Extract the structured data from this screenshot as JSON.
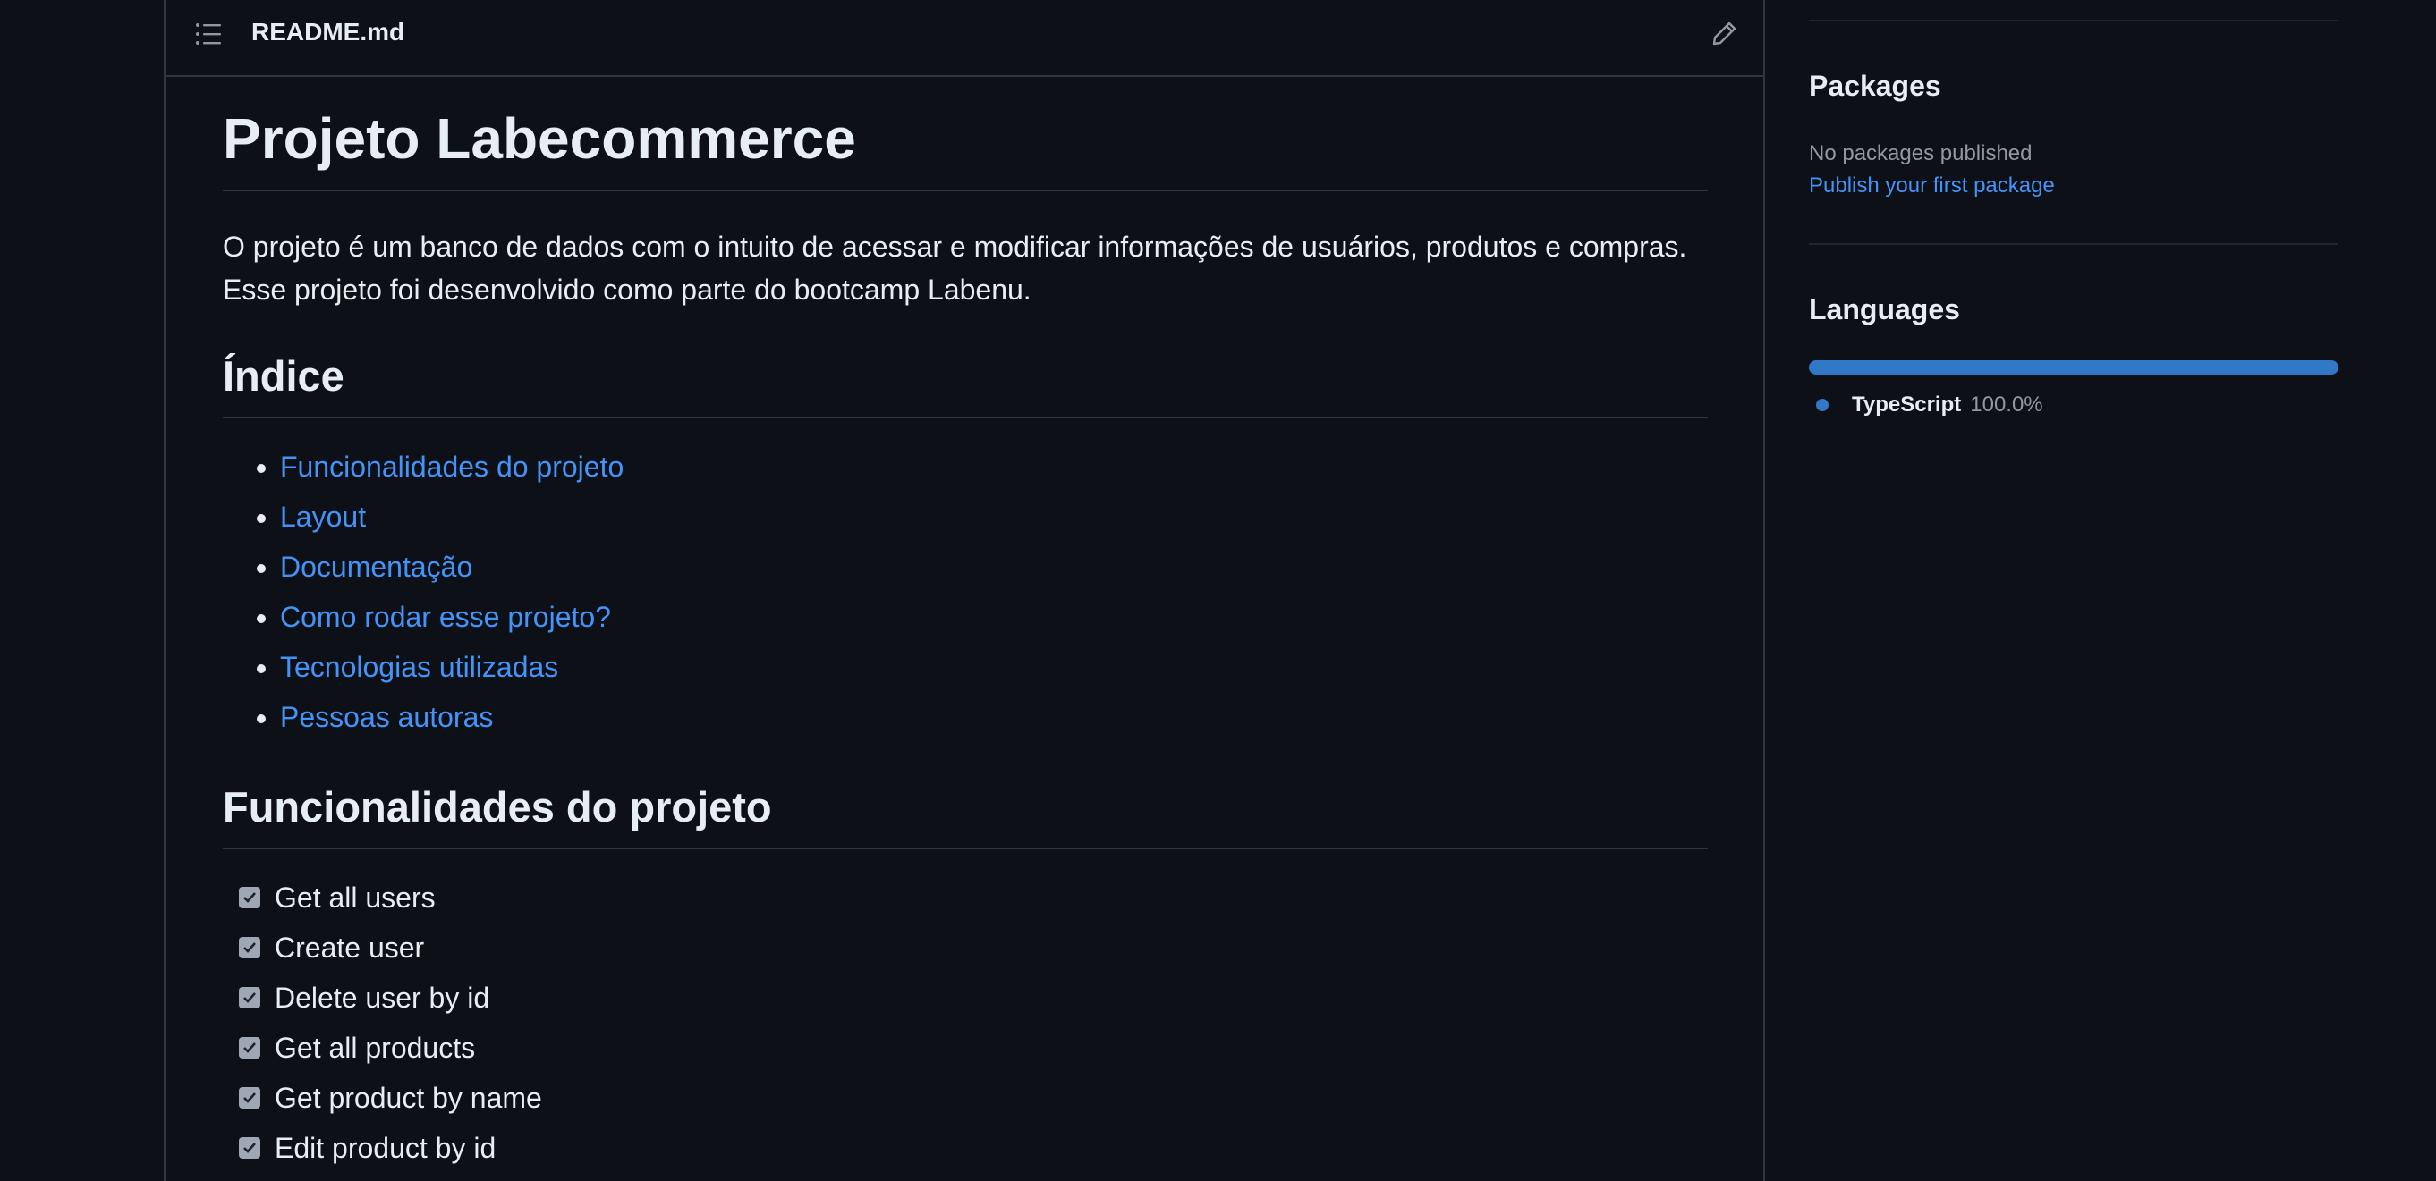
{
  "readme": {
    "filename": "README.md",
    "title": "Projeto Labecommerce",
    "intro": "O projeto é um banco de dados com o intuito de acessar e modificar informações de usuários, produtos e compras. Esse projeto foi desenvolvido como parte do bootcamp Labenu.",
    "index_heading": "Índice",
    "index_items": [
      {
        "label": "Funcionalidades do projeto"
      },
      {
        "label": "Layout"
      },
      {
        "label": "Documentação"
      },
      {
        "label": "Como rodar esse projeto?"
      },
      {
        "label": "Tecnologias utilizadas"
      },
      {
        "label": "Pessoas autoras"
      }
    ],
    "features_heading": "Funcionalidades do projeto",
    "features": [
      {
        "label": "Get all users",
        "checked": true
      },
      {
        "label": "Create user",
        "checked": true
      },
      {
        "label": "Delete user by id",
        "checked": true
      },
      {
        "label": "Get all products",
        "checked": true
      },
      {
        "label": "Get product by name",
        "checked": true
      },
      {
        "label": "Edit product by id",
        "checked": true
      }
    ]
  },
  "sidebar": {
    "packages": {
      "heading": "Packages",
      "empty_text": "No packages published",
      "link": "Publish your first package"
    },
    "languages": {
      "heading": "Languages",
      "items": [
        {
          "name": "TypeScript",
          "percent": "100.0%",
          "share": 1.0,
          "color": "#3178c6"
        }
      ]
    }
  },
  "icons": {
    "toc": "list-unordered-icon",
    "edit": "pencil-icon",
    "check": "check-icon"
  },
  "colors": {
    "background": "#0d1117",
    "border": "#30363d",
    "link": "#4493f8",
    "text": "#e6edf3",
    "muted": "#9198a1",
    "typescript": "#3178c6"
  }
}
